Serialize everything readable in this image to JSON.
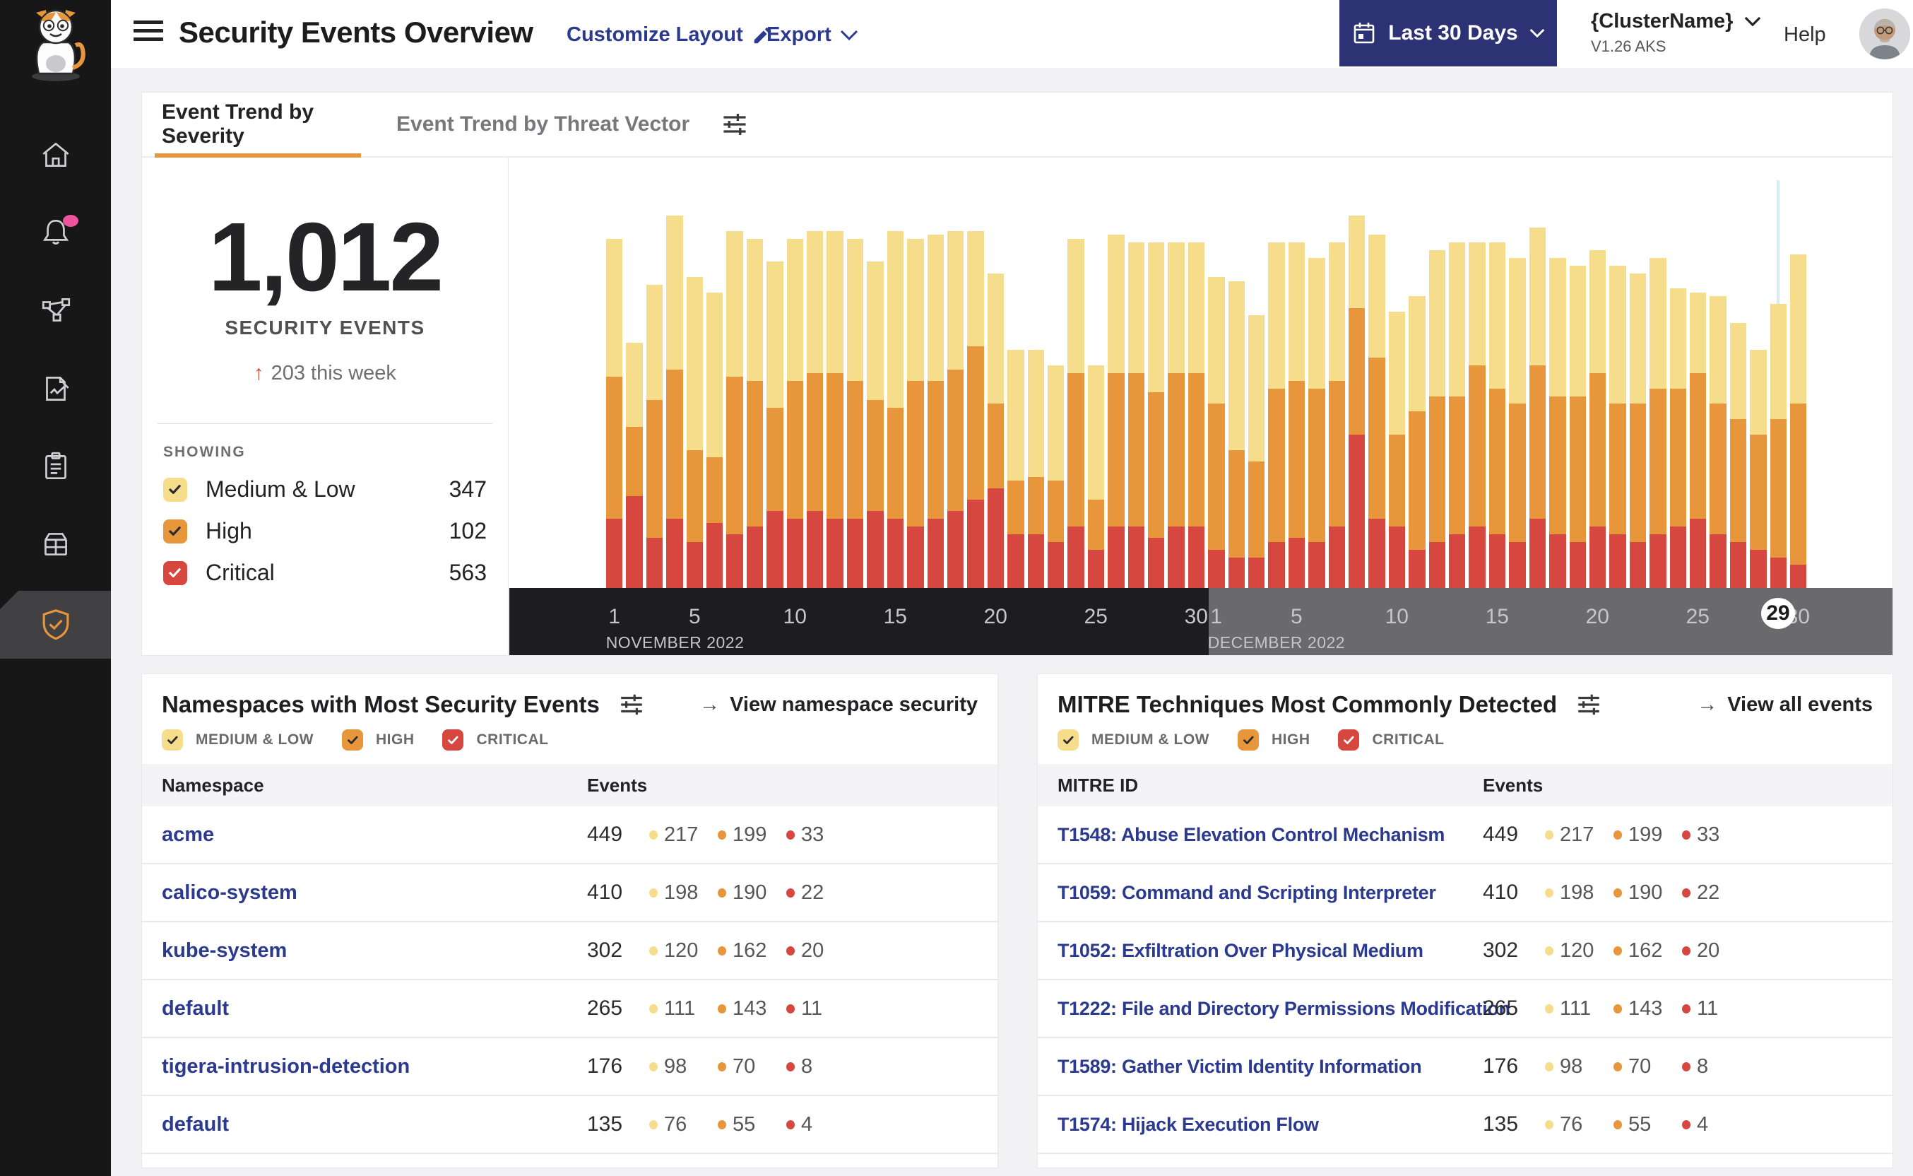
{
  "colors": {
    "medium_low": "#f5dd8b",
    "high": "#e8963c",
    "critical": "#d6473f",
    "accent_orange": "#e8963c",
    "navy_link": "#2b3990",
    "button_bg": "#2d3274",
    "axis_nov_bg": "#1d1d1f",
    "axis_dec_bg": "#6a6a6c",
    "hover_line": "#d8ecf7",
    "notification_pink": "#ee539d"
  },
  "header": {
    "title": "Security Events Overview",
    "customize_label": "Customize Layout",
    "export_label": "Export",
    "date_range_label": "Last 30 Days",
    "cluster_name": "{ClusterName}",
    "cluster_version": "V1.26 AKS",
    "help_label": "Help"
  },
  "sidebar": {
    "items": [
      {
        "icon": "home-icon",
        "active": false,
        "badge": false
      },
      {
        "icon": "bell-icon",
        "active": false,
        "badge": true
      },
      {
        "icon": "service-graph-icon",
        "active": false,
        "badge": false
      },
      {
        "icon": "policy-edit-icon",
        "active": false,
        "badge": false
      },
      {
        "icon": "clipboard-icon",
        "active": false,
        "badge": false
      },
      {
        "icon": "storage-icon",
        "active": false,
        "badge": false
      },
      {
        "icon": "shield-check-icon",
        "active": true,
        "badge": false
      }
    ]
  },
  "tabs": {
    "tab1": "Event Trend by Severity",
    "tab2": "Event Trend by Threat Vector"
  },
  "summary": {
    "total": "1,012",
    "total_label": "SECURITY EVENTS",
    "delta_arrow": "↑",
    "delta_text": "203 this week",
    "showing_label": "SHOWING",
    "filters": [
      {
        "severity": "medium_low",
        "label": "Medium & Low",
        "value": "347",
        "checked": true
      },
      {
        "severity": "high",
        "label": "High",
        "value": "102",
        "checked": true
      },
      {
        "severity": "critical",
        "label": "Critical",
        "value": "563",
        "checked": true
      }
    ]
  },
  "severity_filters": [
    {
      "severity": "medium_low",
      "label": "MEDIUM & LOW",
      "checked": true
    },
    {
      "severity": "high",
      "label": "HIGH",
      "checked": true
    },
    {
      "severity": "critical",
      "label": "CRITICAL",
      "checked": true
    }
  ],
  "chart_data": {
    "type": "bar",
    "subtype": "stacked-daily-columns",
    "value_unit": "percent of plot height (estimated from pixels)",
    "stack_order_bottom_to_top": [
      "Critical",
      "High",
      "Medium & Low"
    ],
    "months": [
      {
        "label": "NOVEMBER 2022",
        "days": 30,
        "ticks": [
          1,
          5,
          10,
          15,
          20,
          25,
          30
        ]
      },
      {
        "label": "DECEMBER 2022",
        "days": 30,
        "ticks": [
          1,
          5,
          10,
          15,
          20,
          25,
          30
        ],
        "highlighted_day": 29
      }
    ],
    "highlighted_day_label": "29",
    "series": [
      {
        "name": "Medium & Low",
        "color_key": "medium_low",
        "values": [
          36,
          22,
          30,
          40,
          45,
          43,
          38,
          37,
          38,
          37,
          37,
          37,
          37,
          36,
          46,
          37,
          38,
          36,
          30,
          34,
          34,
          33,
          30,
          35,
          35,
          36,
          34,
          39,
          34,
          34,
          33,
          44,
          38,
          38,
          36,
          34,
          36,
          24,
          32,
          32,
          30,
          38,
          40,
          32,
          38,
          38,
          36,
          36,
          34,
          32,
          36,
          34,
          34,
          26,
          21,
          28,
          25,
          22,
          30,
          39
        ]
      },
      {
        "name": "High",
        "color_key": "high",
        "values": [
          37,
          18,
          36,
          39,
          24,
          17,
          41,
          38,
          27,
          36,
          36,
          38,
          36,
          29,
          29,
          38,
          36,
          37,
          40,
          22,
          14,
          15,
          16,
          40,
          13,
          40,
          40,
          38,
          40,
          40,
          38,
          28,
          25,
          40,
          41,
          40,
          38,
          33,
          42,
          24,
          36,
          38,
          36,
          42,
          38,
          36,
          40,
          36,
          38,
          40,
          34,
          36,
          38,
          36,
          38,
          34,
          32,
          30,
          36,
          42
        ]
      },
      {
        "name": "Critical",
        "color_key": "critical",
        "values": [
          18,
          24,
          13,
          18,
          12,
          17,
          14,
          16,
          20,
          18,
          20,
          18,
          18,
          20,
          18,
          16,
          18,
          20,
          23,
          26,
          14,
          14,
          12,
          16,
          10,
          16,
          16,
          13,
          16,
          16,
          10,
          8,
          8,
          12,
          13,
          12,
          16,
          40,
          18,
          16,
          10,
          12,
          14,
          16,
          14,
          12,
          18,
          14,
          12,
          16,
          14,
          12,
          14,
          16,
          18,
          14,
          12,
          10,
          8,
          6
        ]
      }
    ]
  },
  "namespaces_card": {
    "title": "Namespaces with Most Security Events",
    "link_arrow": "→",
    "link": "View namespace security",
    "col1": "Namespace",
    "col2": "Events",
    "rows": [
      {
        "name": "acme",
        "total": "449",
        "counts": [
          "217",
          "199",
          "33"
        ]
      },
      {
        "name": "calico-system",
        "total": "410",
        "counts": [
          "198",
          "190",
          "22"
        ]
      },
      {
        "name": "kube-system",
        "total": "302",
        "counts": [
          "120",
          "162",
          "20"
        ]
      },
      {
        "name": "default",
        "total": "265",
        "counts": [
          "111",
          "143",
          "11"
        ]
      },
      {
        "name": "tigera-intrusion-detection",
        "total": "176",
        "counts": [
          "98",
          "70",
          "8"
        ]
      },
      {
        "name": "default",
        "total": "135",
        "counts": [
          "76",
          "55",
          "4"
        ]
      }
    ]
  },
  "mitre_card": {
    "title": "MITRE Techniques Most Commonly Detected",
    "link_arrow": "→",
    "link": "View all events",
    "col1": "MITRE ID",
    "col2": "Events",
    "rows": [
      {
        "name": "T1548: Abuse Elevation Control Mechanism",
        "total": "449",
        "counts": [
          "217",
          "199",
          "33"
        ]
      },
      {
        "name": "T1059: Command and Scripting Interpreter",
        "total": "410",
        "counts": [
          "198",
          "190",
          "22"
        ]
      },
      {
        "name": "T1052: Exfiltration Over Physical Medium",
        "total": "302",
        "counts": [
          "120",
          "162",
          "20"
        ]
      },
      {
        "name": "T1222: File and Directory Permissions Modification",
        "total": "265",
        "counts": [
          "111",
          "143",
          "11"
        ]
      },
      {
        "name": "T1589: Gather Victim Identity Information",
        "total": "176",
        "counts": [
          "98",
          "70",
          "8"
        ]
      },
      {
        "name": "T1574: Hijack Execution Flow",
        "total": "135",
        "counts": [
          "76",
          "55",
          "4"
        ]
      }
    ]
  }
}
